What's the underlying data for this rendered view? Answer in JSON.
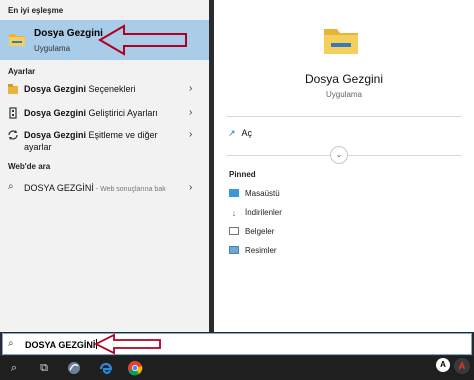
{
  "left": {
    "best_match_header": "En iyi eşleşme",
    "best_match": {
      "title": "Dosya Gezgini",
      "subtitle": "Uygulama"
    },
    "settings_header": "Ayarlar",
    "settings": [
      {
        "bold": "Dosya Gezgini",
        "rest": " Seçenekleri"
      },
      {
        "bold": "Dosya Gezgini",
        "rest": " Geliştirici Ayarları"
      },
      {
        "bold": "Dosya Gezgini",
        "rest": " Eşitleme ve diğer ayarlar"
      }
    ],
    "web_header": "Web'de ara",
    "web_item": {
      "term": "DOSYA GEZGİNİ",
      "sub": " - Web sonuçlarına bak"
    }
  },
  "right": {
    "title": "Dosya Gezgini",
    "subtitle": "Uygulama",
    "open": "Aç",
    "pinned_header": "Pinned",
    "pinned": [
      "Masaüstü",
      "İndirilenler",
      "Belgeler",
      "Resimler"
    ]
  },
  "search": {
    "value": "DOSYA GEZGİNİ"
  },
  "icons": {
    "folder": "folder-icon",
    "search": "search-icon",
    "open": "open-icon"
  },
  "colors": {
    "selected": "#a9cce8",
    "accent": "#1a73c8",
    "arrow": "#b0001e"
  }
}
